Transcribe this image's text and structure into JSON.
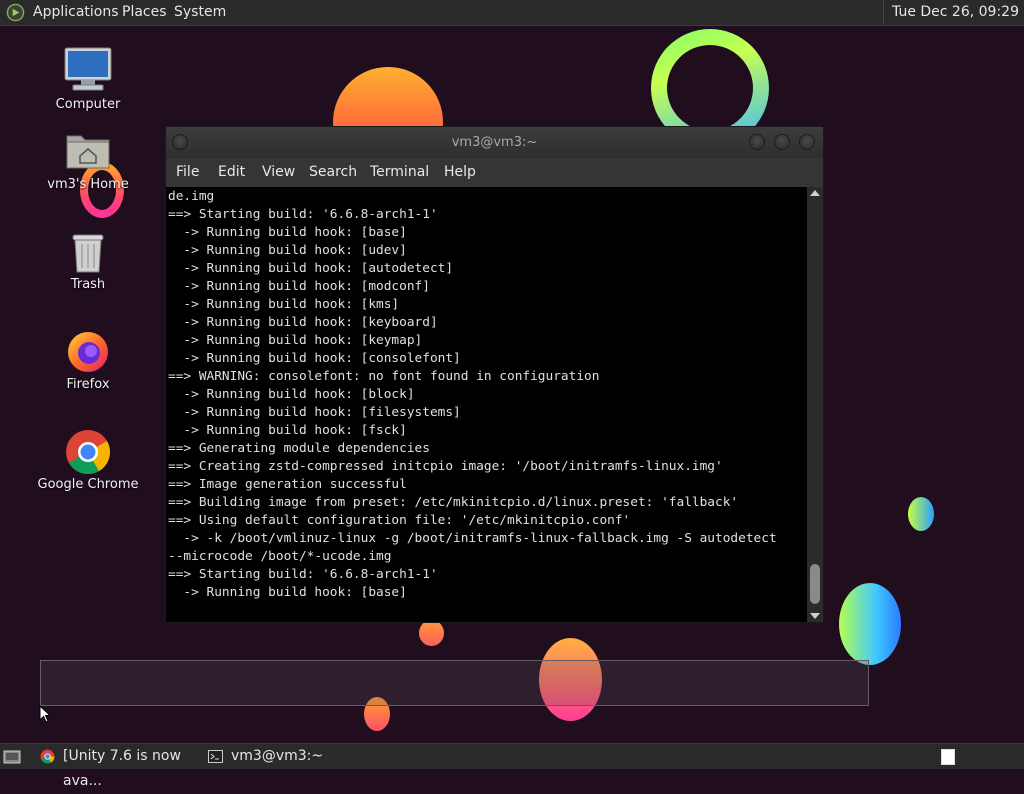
{
  "top_panel": {
    "applications": "Applications",
    "places": "Places",
    "system": "System",
    "clock": "Tue Dec 26, 09:29"
  },
  "desktop_icons": [
    {
      "label": "Computer",
      "icon": "computer-icon"
    },
    {
      "label": "vm3's Home",
      "icon": "home-folder-icon"
    },
    {
      "label": "Trash",
      "icon": "trash-icon"
    },
    {
      "label": "Firefox",
      "icon": "firefox-icon"
    },
    {
      "label": "Google Chrome",
      "icon": "chrome-icon"
    }
  ],
  "terminal": {
    "title": "vm3@vm3:~",
    "menu": [
      "File",
      "Edit",
      "View",
      "Search",
      "Terminal",
      "Help"
    ],
    "lines": [
      "de.img",
      "==> Starting build: '6.6.8-arch1-1'",
      "  -> Running build hook: [base]",
      "  -> Running build hook: [udev]",
      "  -> Running build hook: [autodetect]",
      "  -> Running build hook: [modconf]",
      "  -> Running build hook: [kms]",
      "  -> Running build hook: [keyboard]",
      "  -> Running build hook: [keymap]",
      "  -> Running build hook: [consolefont]",
      "==> WARNING: consolefont: no font found in configuration",
      "  -> Running build hook: [block]",
      "  -> Running build hook: [filesystems]",
      "  -> Running build hook: [fsck]",
      "==> Generating module dependencies",
      "==> Creating zstd-compressed initcpio image: '/boot/initramfs-linux.img'",
      "==> Image generation successful",
      "==> Building image from preset: /etc/mkinitcpio.d/linux.preset: 'fallback'",
      "==> Using default configuration file: '/etc/mkinitcpio.conf'",
      "  -> -k /boot/vmlinuz-linux -g /boot/initramfs-linux-fallback.img -S autodetect",
      "--microcode /boot/*-ucode.img",
      "==> Starting build: '6.6.8-arch1-1'",
      "  -> Running build hook: [base]"
    ]
  },
  "bottom_panel": {
    "tasks": [
      {
        "label": "[Unity 7.6 is now ava...",
        "icon": "chrome-icon"
      },
      {
        "label": "vm3@vm3:~",
        "icon": "terminal-icon"
      }
    ]
  },
  "colors": {
    "desktop_bg": "#200e1e",
    "panel_bg": "#2a2a2a",
    "terminal_bg": "#000000",
    "terminal_fg": "#e0e0e0"
  }
}
